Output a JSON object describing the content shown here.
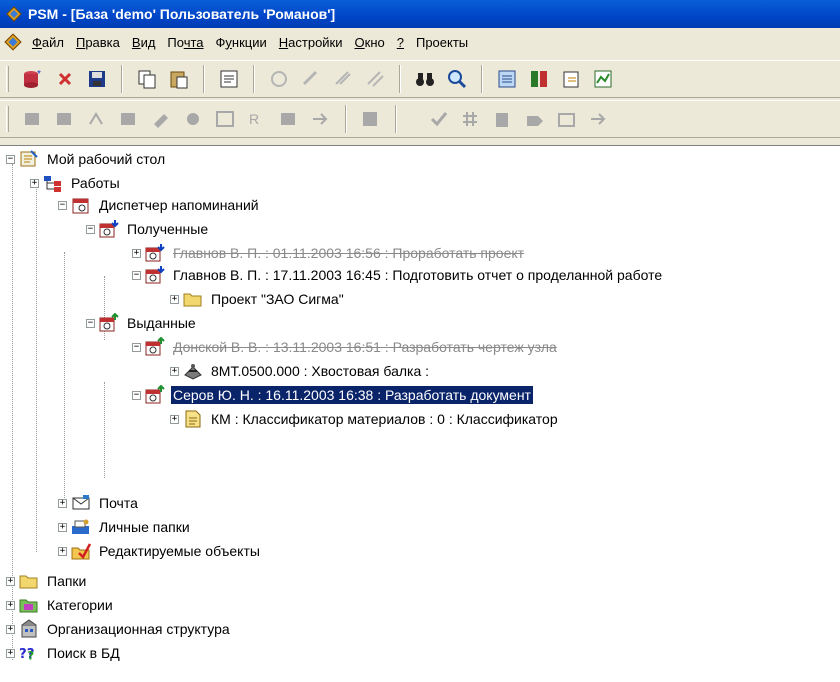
{
  "window": {
    "title": "PSM - [База 'demo' Пользователь 'Романов']"
  },
  "menu": [
    {
      "pre": "",
      "ul": "Ф",
      "post": "айл"
    },
    {
      "pre": "",
      "ul": "П",
      "post": "равка"
    },
    {
      "pre": "",
      "ul": "В",
      "post": "ид"
    },
    {
      "pre": "",
      "ul": "По",
      "post": "чта",
      "ulIndex": 1
    },
    {
      "pre": "Ф",
      "ul": "у",
      "post": "нкции"
    },
    {
      "pre": "",
      "ul": "Н",
      "post": "астройки"
    },
    {
      "pre": "",
      "ul": "О",
      "post": "кно"
    },
    {
      "pre": "",
      "ul": "?",
      "post": ""
    },
    {
      "pre": "",
      "ul": "",
      "post": "Проекты"
    }
  ],
  "toolbar1": [
    "db-add-icon",
    "delete-icon",
    "save-icon",
    "copy-icon",
    "paste-icon",
    "properties-icon",
    "grey-tool-1-icon",
    "grey-tool-2-icon",
    "grey-tool-3-icon",
    "grey-tool-4-icon",
    "binoculars-icon",
    "find-icon",
    "document-icon",
    "hierarchy-icon",
    "export-icon",
    "graph-icon"
  ],
  "toolbar2": [
    "grey-search-1-icon",
    "grey-search-2-icon",
    "grey-search-3-icon",
    "grey-search-4-icon",
    "grey-search-5-icon",
    "grey-search-6-icon",
    "grey-search-7-icon",
    "grey-search-8-icon",
    "grey-search-9-icon",
    "grey-search-10-icon",
    "grey-search-11-icon",
    "check-icon",
    "hash-new-icon",
    "doc-new-icon",
    "tag-new-icon",
    "table-new-icon",
    "arrow-new-icon"
  ],
  "tree": {
    "desktop": "Мой рабочий стол",
    "works": "Работы",
    "reminders": "Диспетчер напоминаний",
    "received": "Полученные",
    "received_item1": "Главнов В. П. : 01.11.2003 16:56 : Проработать проект",
    "received_item2": "Главнов В. П. : 17.11.2003 16:45 : Подготовить отчет о проделанной работе",
    "project": "Проект \"ЗАО Сигма\"",
    "issued": "Выданные",
    "issued_item1": "Донской В. В. : 13.11.2003 16:51 : Разработать чертеж узла",
    "part": "8МТ.0500.000 : Хвостовая балка :",
    "issued_item2": "Серов Ю. Н. : 16.11.2003 16:38 : Разработать документ",
    "classifier": "КМ : Классификатор материалов : 0 : Классификатор",
    "mail": "Почта",
    "personal": "Личные папки",
    "editable": "Редактируемые объекты",
    "folders": "Папки",
    "categories": "Категории",
    "org": "Организационная структура",
    "search": "Поиск в БД"
  }
}
